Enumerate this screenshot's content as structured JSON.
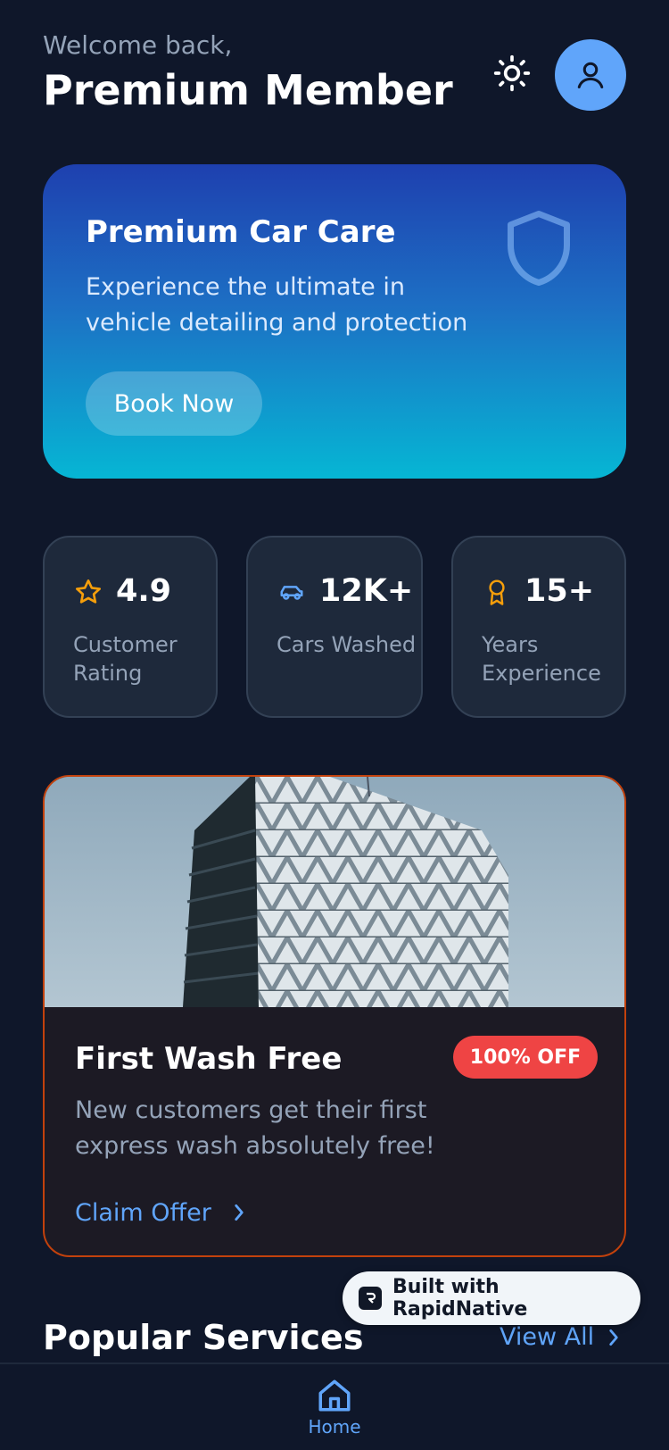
{
  "header": {
    "welcome": "Welcome back,",
    "member_name": "Premium Member",
    "theme_icon": "sun-icon",
    "avatar_icon": "user-icon"
  },
  "hero": {
    "title": "Premium Car Care",
    "description": "Experience the ultimate in vehicle detailing and protection",
    "button_label": "Book Now",
    "icon": "shield-icon"
  },
  "stats": [
    {
      "icon": "star-icon",
      "value": "4.9",
      "label": "Customer Rating",
      "icon_color": "#f59e0b"
    },
    {
      "icon": "car-icon",
      "value": "12K+",
      "label": "Cars Washed",
      "icon_color": "#60a5fa"
    },
    {
      "icon": "award-icon",
      "value": "15+",
      "label": "Years Experience",
      "icon_color": "#f59e0b"
    }
  ],
  "offer": {
    "title": "First Wash Free",
    "badge": "100% OFF",
    "description": "New customers get their first express wash absolutely free!",
    "cta": "Claim Offer"
  },
  "popular": {
    "title": "Popular Services",
    "view_all": "View All"
  },
  "built_with": "Built with RapidNative",
  "tabbar": {
    "home_label": "Home"
  },
  "colors": {
    "background": "#0f172a",
    "accent": "#60a5fa",
    "badge": "#ef4444",
    "offer_border": "#c2410c"
  }
}
